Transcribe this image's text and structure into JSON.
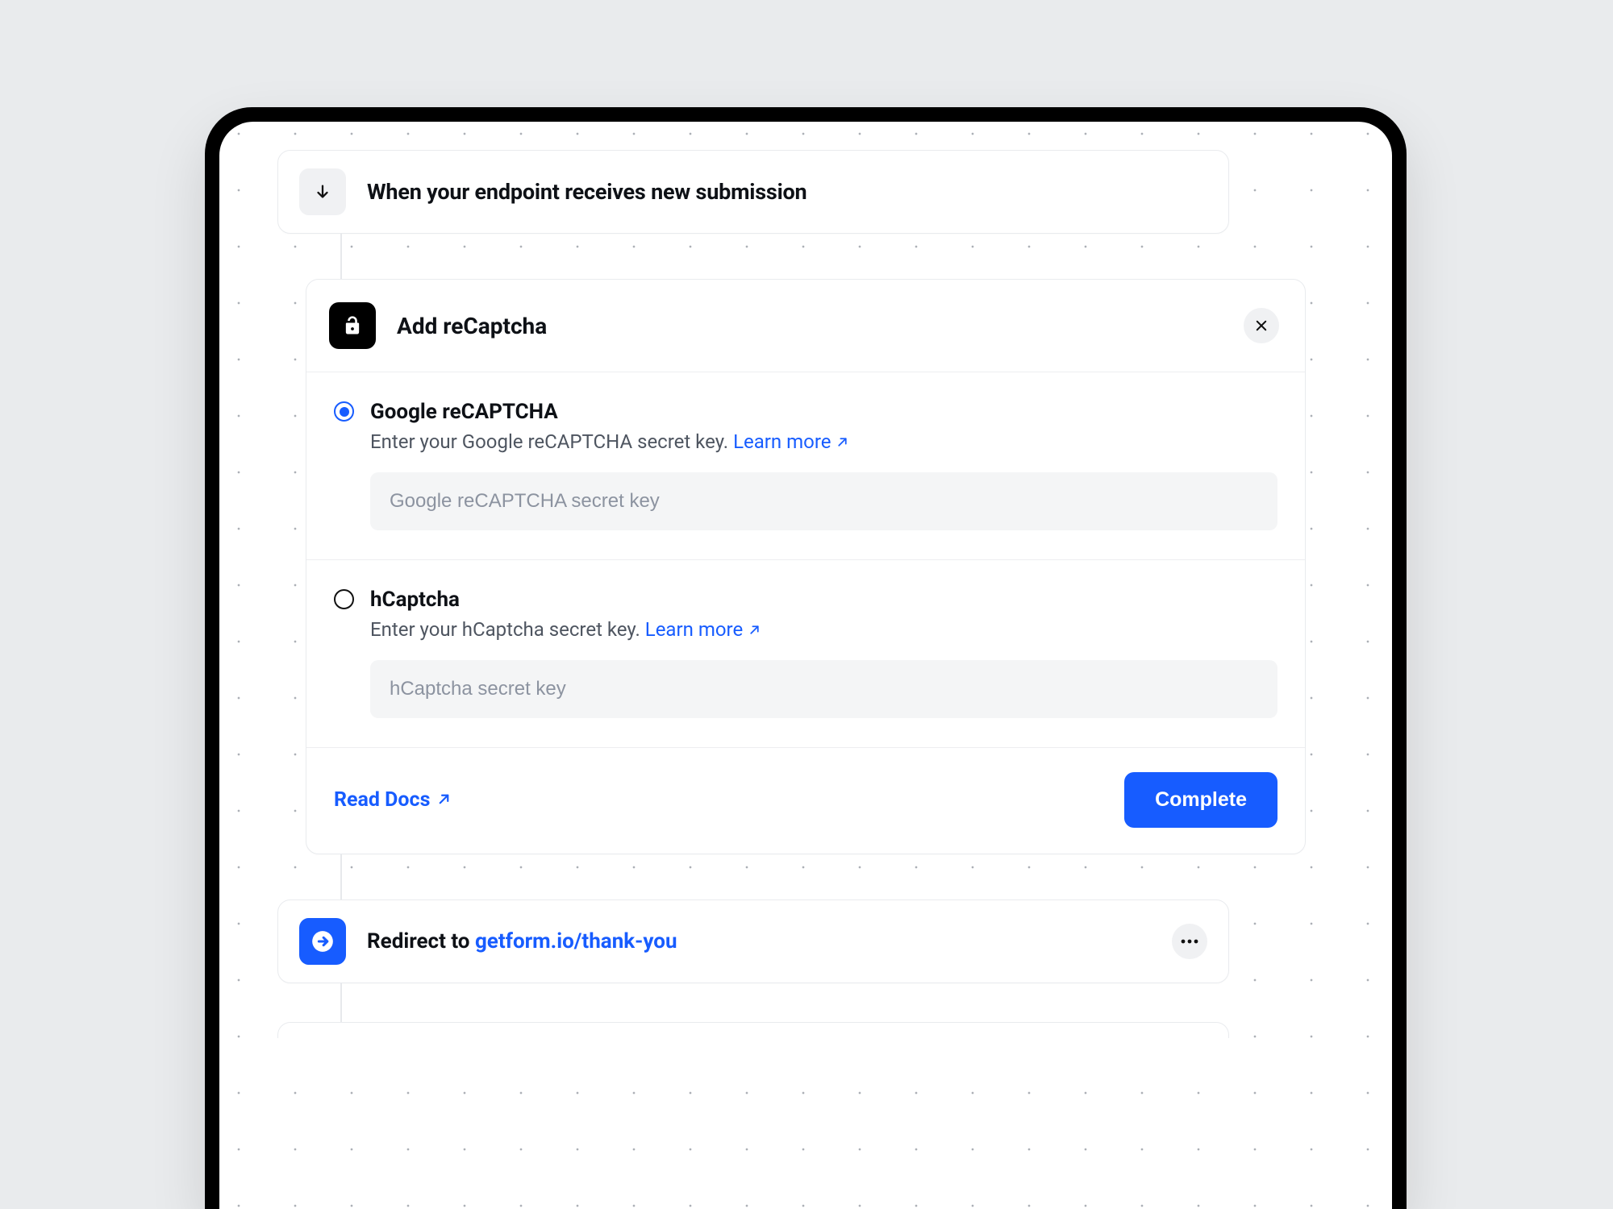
{
  "trigger": {
    "title": "When your endpoint receives new submission"
  },
  "step": {
    "title": "Add reCaptcha",
    "options": [
      {
        "label": "Google reCAPTCHA",
        "desc": "Enter your Google reCAPTCHA secret key.",
        "learn": "Learn more",
        "placeholder": "Google reCAPTCHA secret key"
      },
      {
        "label": "hCaptcha",
        "desc": "Enter your hCaptcha secret key.",
        "learn": "Learn more",
        "placeholder": "hCaptcha secret key"
      }
    ],
    "readDocs": "Read Docs",
    "complete": "Complete"
  },
  "redirect": {
    "prefix": "Redirect to ",
    "url": "getform.io/thank-you"
  }
}
